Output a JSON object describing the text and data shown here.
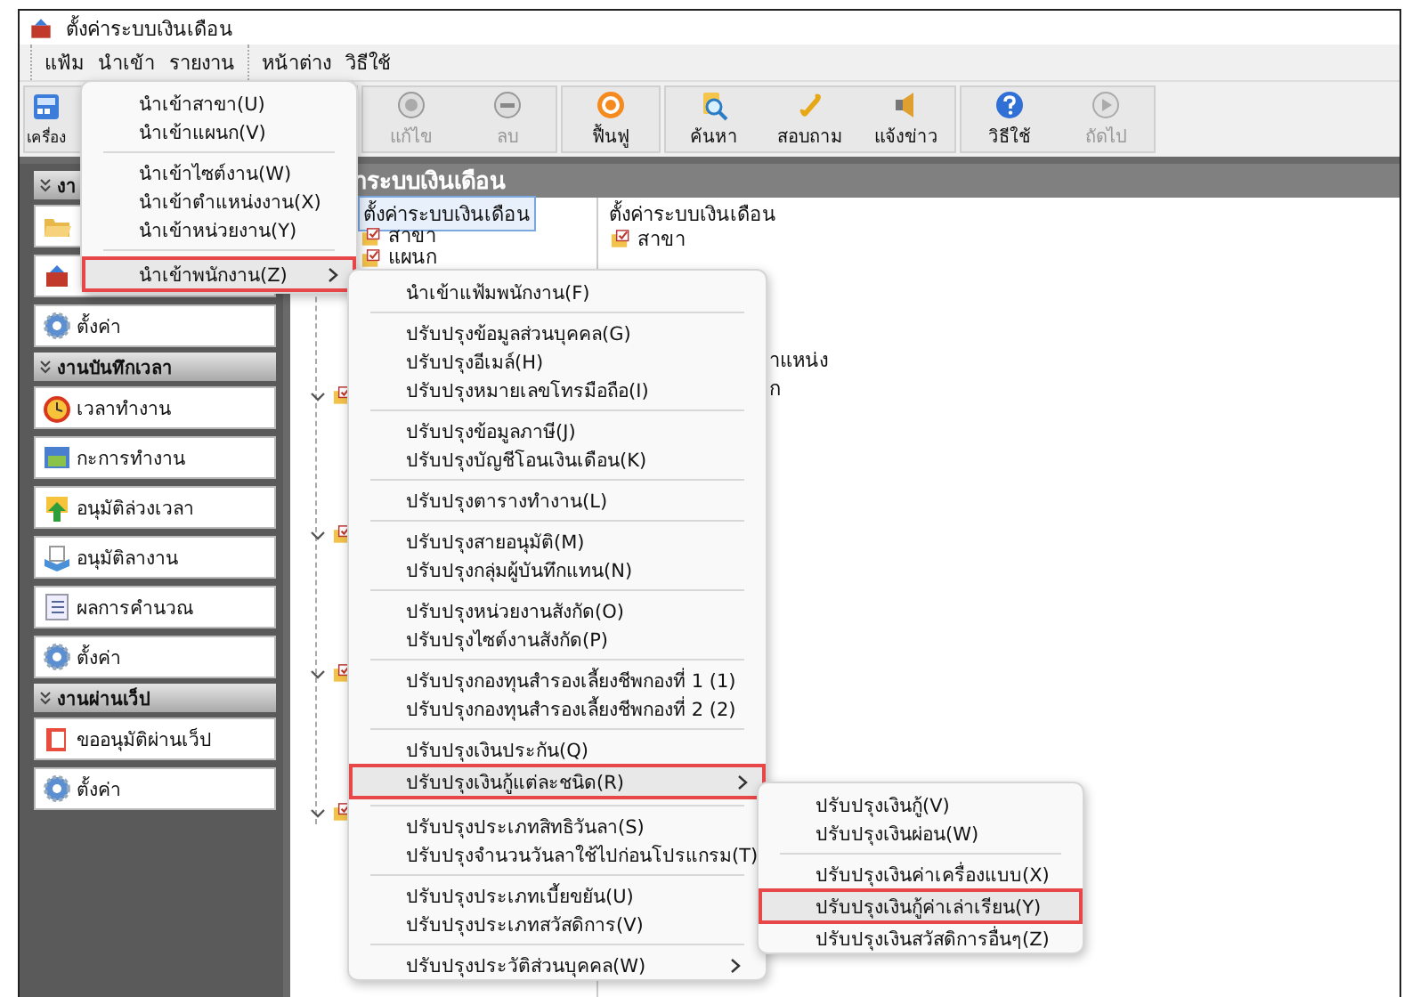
{
  "window": {
    "title": "ตั้งค่าระบบเงินเดือน"
  },
  "menu_bar": [
    [
      "แฟ้ม",
      "นำเข้า",
      "รายงาน"
    ],
    [
      "หน้าต่าง",
      "วิธีใช้"
    ]
  ],
  "toolbar": [
    [
      {
        "label": "เครื่อง",
        "disabled": false
      }
    ],
    [
      {
        "label": "แก้ไข",
        "disabled": true
      },
      {
        "label": "ลบ",
        "disabled": true
      }
    ],
    [
      {
        "label": "ฟื้นฟู",
        "disabled": false
      }
    ],
    [
      {
        "label": "ค้นหา",
        "disabled": false
      },
      {
        "label": "สอบถาม",
        "disabled": false
      },
      {
        "label": "แจ้งข่าว",
        "disabled": false
      }
    ],
    [
      {
        "label": "วิธีใช้",
        "disabled": false
      },
      {
        "label": "ถัดไป",
        "disabled": true
      }
    ]
  ],
  "sidebar": {
    "groups": [
      {
        "title": "งา",
        "items": [
          {
            "kind": "covered"
          },
          {
            "kind": "covered"
          },
          {
            "kind": "labeled",
            "label": "ตั้งค่า"
          }
        ]
      },
      {
        "title": "งานบันทึกเวลา",
        "items": [
          {
            "label": "เวลาทำงาน"
          },
          {
            "label": "กะการทำงาน"
          },
          {
            "label": "อนุมัติล่วงเวลา"
          },
          {
            "label": "อนุมัติลางาน"
          },
          {
            "label": "ผลการคำนวณ"
          },
          {
            "label": "ตั้งค่า"
          }
        ]
      },
      {
        "title": "งานผ่านเว็ป",
        "items": [
          {
            "label": "ขออนุมัติผ่านเว็ป"
          },
          {
            "label": "ตั้งค่า"
          }
        ]
      }
    ]
  },
  "main_panel": {
    "title": "าระบบเงินเดือน"
  },
  "tree": {
    "root": {
      "label": "ตั้งค่าระบบเงินเดือน",
      "selected": true,
      "children": [
        {
          "label": "สาขา"
        },
        {
          "label": "แผนก"
        },
        {
          "expanded": true
        },
        {
          "expanded": true
        },
        {
          "expanded": true
        },
        {
          "expanded": true
        }
      ]
    }
  },
  "list": {
    "items": [
      {
        "label": "ตั้งค่าระบบเงินเดือน"
      },
      {
        "label": "สาขา"
      }
    ],
    "fragments": [
      "าแหน่ง",
      "ก"
    ]
  },
  "import_menu": {
    "groups": [
      [
        {
          "label": "นำเข้าสาขา(U)",
          "selected": false,
          "has_submenu": false
        },
        {
          "label": "นำเข้าแผนก(V)",
          "selected": false,
          "has_submenu": false
        }
      ],
      [
        {
          "label": "นำเข้าไซต์งาน(W)",
          "selected": false,
          "has_submenu": false
        },
        {
          "label": "นำเข้าตำแหน่งงาน(X)",
          "selected": false,
          "has_submenu": false
        },
        {
          "label": "นำเข้าหน่วยงาน(Y)",
          "selected": false,
          "has_submenu": false
        }
      ],
      [
        {
          "label": "นำเข้าพนักงาน(Z)",
          "selected": true,
          "has_submenu": true
        }
      ]
    ]
  },
  "employee_menu": {
    "groups": [
      [
        {
          "label": "นำเข้าแฟ้มพนักงาน(F)",
          "selected": false,
          "has_submenu": false
        }
      ],
      [
        {
          "label": "ปรับปรุงข้อมูลส่วนบุคคล(G)",
          "selected": false,
          "has_submenu": false
        },
        {
          "label": "ปรับปรุงอีเมล์(H)",
          "selected": false,
          "has_submenu": false
        },
        {
          "label": "ปรับปรุงหมายเลขโทรมือถือ(I)",
          "selected": false,
          "has_submenu": false
        }
      ],
      [
        {
          "label": "ปรับปรุงข้อมูลภาษี(J)",
          "selected": false,
          "has_submenu": false
        },
        {
          "label": "ปรับปรุงบัญชีโอนเงินเดือน(K)",
          "selected": false,
          "has_submenu": false
        }
      ],
      [
        {
          "label": "ปรับปรุงตารางทำงาน(L)",
          "selected": false,
          "has_submenu": false
        }
      ],
      [
        {
          "label": "ปรับปรุงสายอนุมัติ(M)",
          "selected": false,
          "has_submenu": false
        },
        {
          "label": "ปรับปรุงกลุ่มผู้บันทึกแทน(N)",
          "selected": false,
          "has_submenu": false
        }
      ],
      [
        {
          "label": "ปรับปรุงหน่วยงานสังกัด(O)",
          "selected": false,
          "has_submenu": false
        },
        {
          "label": "ปรับปรุงไซต์งานสังกัด(P)",
          "selected": false,
          "has_submenu": false
        }
      ],
      [
        {
          "label": "ปรับปรุงกองทุนสำรองเลี้ยงชีพกองที่ 1 (1)",
          "selected": false,
          "has_submenu": false
        },
        {
          "label": "ปรับปรุงกองทุนสำรองเลี้ยงชีพกองที่ 2 (2)",
          "selected": false,
          "has_submenu": false
        }
      ],
      [
        {
          "label": "ปรับปรุงเงินประกัน(Q)",
          "selected": false,
          "has_submenu": false
        },
        {
          "label": "ปรับปรุงเงินกู้แต่ละชนิด(R)",
          "selected": true,
          "has_submenu": true
        }
      ],
      [
        {
          "label": "ปรับปรุงประเภทสิทธิวันลา(S)",
          "selected": false,
          "has_submenu": false
        },
        {
          "label": "ปรับปรุงจำนวนวันลาใช้ไปก่อนโปรแกรม(T)",
          "selected": false,
          "has_submenu": false
        }
      ],
      [
        {
          "label": "ปรับปรุงประเภทเบี้ยขยัน(U)",
          "selected": false,
          "has_submenu": false
        },
        {
          "label": "ปรับปรุงประเภทสวัสดิการ(V)",
          "selected": false,
          "has_submenu": false
        }
      ],
      [
        {
          "label": "ปรับปรุงประวัติส่วนบุคคล(W)",
          "selected": false,
          "has_submenu": true
        }
      ]
    ]
  },
  "loan_menu": {
    "groups": [
      [
        {
          "label": "ปรับปรุงเงินกู้(V)",
          "selected": false,
          "has_submenu": false
        },
        {
          "label": "ปรับปรุงเงินผ่อน(W)",
          "selected": false,
          "has_submenu": false
        }
      ],
      [
        {
          "label": "ปรับปรุงเงินค่าเครื่องแบบ(X)",
          "selected": false,
          "has_submenu": false
        },
        {
          "label": "ปรับปรุงเงินกู้ค่าเล่าเรียน(Y)",
          "selected": true,
          "has_submenu": false
        },
        {
          "label": "ปรับปรุงเงินสวัสดิการอื่นๆ(Z)",
          "selected": false,
          "has_submenu": false
        }
      ]
    ]
  }
}
